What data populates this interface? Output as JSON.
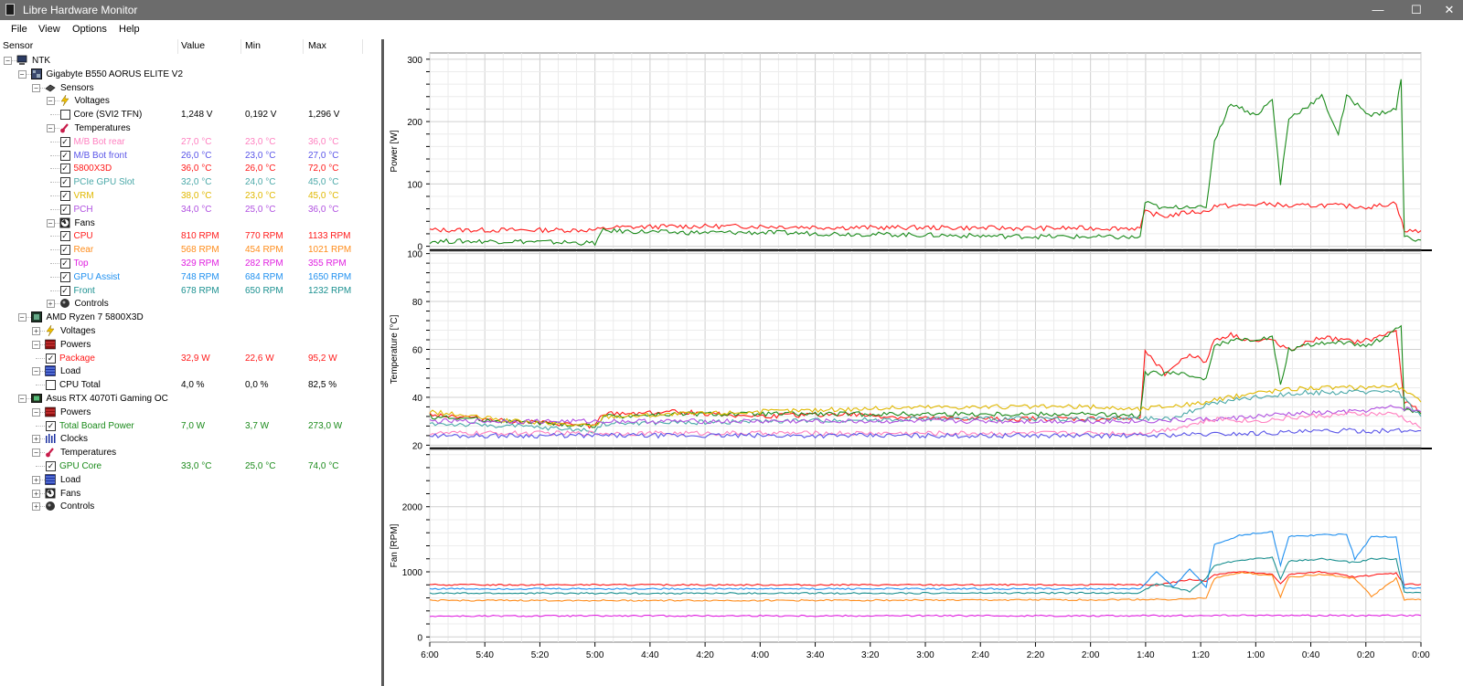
{
  "window": {
    "title": "Libre Hardware Monitor",
    "minimize": "—",
    "maximize": "☐",
    "close": "✕"
  },
  "menu": [
    "File",
    "View",
    "Options",
    "Help"
  ],
  "columns": {
    "sensor": "Sensor",
    "value": "Value",
    "min": "Min",
    "max": "Max"
  },
  "tree": [
    {
      "level": 0,
      "exp": "−",
      "icon": "computer-icon",
      "label": "NTK",
      "name": "computer-ntk"
    },
    {
      "level": 1,
      "exp": "−",
      "icon": "motherboard-icon",
      "label": "Gigabyte B550 AORUS ELITE V2",
      "name": "motherboard"
    },
    {
      "level": 2,
      "exp": "−",
      "icon": "chip-icon",
      "label": "Sensors",
      "name": "sensors-group"
    },
    {
      "level": 3,
      "exp": "−",
      "icon": "voltage-icon",
      "label": "Voltages",
      "name": "voltages-group"
    },
    {
      "level": 4,
      "check": false,
      "label": "Core (SVI2 TFN)",
      "value": "1,248 V",
      "min": "0,192 V",
      "max": "1,296 V",
      "color": "#000000",
      "name": "core-svi2-tfn"
    },
    {
      "level": 3,
      "exp": "−",
      "icon": "thermometer-icon",
      "label": "Temperatures",
      "name": "temperatures-group"
    },
    {
      "level": 4,
      "check": true,
      "label": "M/B Bot rear",
      "value": "27,0 °C",
      "min": "23,0 °C",
      "max": "36,0 °C",
      "color": "#ff80c0",
      "name": "mb-bot-rear"
    },
    {
      "level": 4,
      "check": true,
      "label": "M/B Bot front",
      "value": "26,0 °C",
      "min": "23,0 °C",
      "max": "27,0 °C",
      "color": "#5a55e8",
      "name": "mb-bot-front"
    },
    {
      "level": 4,
      "check": true,
      "label": "5800X3D",
      "value": "36,0 °C",
      "min": "26,0 °C",
      "max": "72,0 °C",
      "color": "#ff1a1a",
      "name": "temp-5800x3d"
    },
    {
      "level": 4,
      "check": true,
      "label": "PCIe GPU Slot",
      "value": "32,0 °C",
      "min": "24,0 °C",
      "max": "45,0 °C",
      "color": "#4aa8a8",
      "name": "pcie-gpu-slot"
    },
    {
      "level": 4,
      "check": true,
      "label": "VRM",
      "value": "38,0 °C",
      "min": "23,0 °C",
      "max": "45,0 °C",
      "color": "#e0b800",
      "name": "vrm"
    },
    {
      "level": 4,
      "check": true,
      "label": "PCH",
      "value": "34,0 °C",
      "min": "25,0 °C",
      "max": "36,0 °C",
      "color": "#b050e0",
      "name": "pch"
    },
    {
      "level": 3,
      "exp": "−",
      "icon": "fan-icon",
      "label": "Fans",
      "name": "fans-group"
    },
    {
      "level": 4,
      "check": true,
      "label": "CPU",
      "value": "810 RPM",
      "min": "770 RPM",
      "max": "1133 RPM",
      "color": "#ff1a1a",
      "name": "fan-cpu"
    },
    {
      "level": 4,
      "check": true,
      "label": "Rear",
      "value": "568 RPM",
      "min": "454 RPM",
      "max": "1021 RPM",
      "color": "#ff8c1a",
      "name": "fan-rear"
    },
    {
      "level": 4,
      "check": true,
      "label": "Top",
      "value": "329 RPM",
      "min": "282 RPM",
      "max": "355 RPM",
      "color": "#e020e0",
      "name": "fan-top"
    },
    {
      "level": 4,
      "check": true,
      "label": "GPU Assist",
      "value": "748 RPM",
      "min": "684 RPM",
      "max": "1650 RPM",
      "color": "#2090f0",
      "name": "fan-gpu-assist"
    },
    {
      "level": 4,
      "check": true,
      "label": "Front",
      "value": "678 RPM",
      "min": "650 RPM",
      "max": "1232 RPM",
      "color": "#1a9090",
      "name": "fan-front"
    },
    {
      "level": 3,
      "exp": "+",
      "icon": "controls-icon",
      "label": "Controls",
      "name": "controls-group-mb"
    },
    {
      "level": 1,
      "exp": "−",
      "icon": "cpu-icon",
      "label": "AMD Ryzen 7 5800X3D",
      "name": "cpu-device"
    },
    {
      "level": 2,
      "exp": "+",
      "icon": "voltage-icon",
      "label": "Voltages",
      "name": "cpu-voltages-group"
    },
    {
      "level": 2,
      "exp": "−",
      "icon": "power-icon",
      "label": "Powers",
      "name": "cpu-powers-group"
    },
    {
      "level": 3,
      "check": true,
      "label": "Package",
      "value": "32,9 W",
      "min": "22,6 W",
      "max": "95,2 W",
      "color": "#ff1a1a",
      "name": "cpu-package"
    },
    {
      "level": 2,
      "exp": "−",
      "icon": "load-icon",
      "label": "Load",
      "name": "cpu-load-group"
    },
    {
      "level": 3,
      "check": false,
      "label": "CPU Total",
      "value": "4,0 %",
      "min": "0,0 %",
      "max": "82,5 %",
      "color": "#000000",
      "name": "cpu-total"
    },
    {
      "level": 1,
      "exp": "−",
      "icon": "gpu-icon",
      "label": "Asus RTX 4070Ti Gaming OC",
      "name": "gpu-device"
    },
    {
      "level": 2,
      "exp": "−",
      "icon": "power-icon",
      "label": "Powers",
      "name": "gpu-powers-group"
    },
    {
      "level": 3,
      "check": true,
      "label": "Total Board Power",
      "value": "7,0 W",
      "min": "3,7 W",
      "max": "273,0 W",
      "color": "#1a8a1a",
      "name": "gpu-total-board-power"
    },
    {
      "level": 2,
      "exp": "+",
      "icon": "clock-icon",
      "label": "Clocks",
      "name": "gpu-clocks-group"
    },
    {
      "level": 2,
      "exp": "−",
      "icon": "thermometer-icon",
      "label": "Temperatures",
      "name": "gpu-temperatures-group"
    },
    {
      "level": 3,
      "check": true,
      "label": "GPU Core",
      "value": "33,0 °C",
      "min": "25,0 °C",
      "max": "74,0 °C",
      "color": "#1a8a1a",
      "name": "gpu-core-temp"
    },
    {
      "level": 2,
      "exp": "+",
      "icon": "load-icon",
      "label": "Load",
      "name": "gpu-load-group"
    },
    {
      "level": 2,
      "exp": "+",
      "icon": "fan-icon",
      "label": "Fans",
      "name": "gpu-fans-group"
    },
    {
      "level": 2,
      "exp": "+",
      "icon": "controls-icon",
      "label": "Controls",
      "name": "gpu-controls-group"
    }
  ],
  "chart_data": {
    "type": "line",
    "x_ticks": [
      "6:00",
      "5:40",
      "5:20",
      "5:00",
      "4:40",
      "4:20",
      "4:00",
      "3:40",
      "3:20",
      "3:00",
      "2:40",
      "2:20",
      "2:00",
      "1:40",
      "1:20",
      "1:00",
      "0:40",
      "0:20",
      "0:00"
    ],
    "panels": [
      {
        "ylabel": "Power [W]",
        "ylim": [
          -5,
          310
        ],
        "yticks": [
          0,
          100,
          200,
          300
        ],
        "series": [
          {
            "name": "Package",
            "color": "#ff1a1a",
            "x": [
              6,
              5,
              4.9,
              4.5,
              4,
              3.5,
              3,
              2.5,
              2,
              1.7,
              1.67,
              1.55,
              1.4,
              1.3,
              1.25,
              1.1,
              1.0,
              0.9,
              0.8,
              0.6,
              0.4,
              0.3,
              0.15,
              0.1,
              0
            ],
            "y": [
              26,
              26,
              30,
              32,
              32,
              30,
              30,
              29,
              29,
              29,
              55,
              48,
              55,
              55,
              65,
              65,
              67,
              68,
              64,
              66,
              64,
              63,
              70,
              24,
              25
            ]
          },
          {
            "name": "Total Board Power",
            "color": "#1a8a1a",
            "x": [
              6,
              5.5,
              5,
              4.95,
              4.5,
              4,
              3.5,
              3,
              2.5,
              2,
              1.7,
              1.67,
              1.55,
              1.4,
              1.3,
              1.25,
              1.15,
              1.0,
              0.9,
              0.85,
              0.8,
              0.6,
              0.5,
              0.45,
              0.3,
              0.15,
              0.12,
              0.1,
              0
            ],
            "y": [
              8,
              8,
              5,
              25,
              22,
              22,
              20,
              18,
              16,
              15,
              14,
              70,
              60,
              65,
              60,
              170,
              230,
              210,
              235,
              100,
              205,
              240,
              180,
              240,
              210,
              220,
              270,
              15,
              10
            ]
          }
        ]
      },
      {
        "ylabel": "Temperature [°C]",
        "ylim": [
          19,
          101
        ],
        "yticks": [
          20,
          40,
          60,
          80,
          100
        ],
        "series": [
          {
            "name": "5800X3D",
            "color": "#ff1a1a",
            "x": [
              6,
              5.5,
              5,
              4.95,
              4.5,
              4,
              3.5,
              3,
              2.5,
              2,
              1.7,
              1.67,
              1.55,
              1.4,
              1.3,
              1.25,
              1.15,
              1.0,
              0.9,
              0.8,
              0.6,
              0.4,
              0.3,
              0.15,
              0.1,
              0
            ],
            "y": [
              33,
              30,
              28,
              33,
              34,
              32,
              33,
              31,
              31,
              31,
              31,
              60,
              50,
              58,
              55,
              64,
              66,
              63,
              64,
              60,
              65,
              63,
              64,
              68,
              38,
              34
            ]
          },
          {
            "name": "GPU Core",
            "color": "#1a8a1a",
            "x": [
              6,
              5.5,
              5,
              4.95,
              4.5,
              4,
              3.5,
              3,
              2.5,
              2,
              1.7,
              1.67,
              1.5,
              1.3,
              1.25,
              1.1,
              0.9,
              0.85,
              0.8,
              0.6,
              0.3,
              0.12,
              0.1,
              0
            ],
            "y": [
              32,
              30,
              28,
              32,
              33,
              33,
              33,
              33,
              33,
              33,
              32,
              50,
              50,
              48,
              62,
              64,
              65,
              45,
              60,
              63,
              62,
              70,
              35,
              33
            ]
          },
          {
            "name": "VRM",
            "color": "#e0b800",
            "x": [
              6,
              5.5,
              5,
              4.95,
              4,
              3,
              2.5,
              2,
              1.7,
              1.6,
              1.4,
              1.3,
              1.0,
              0.7,
              0.4,
              0.15,
              0
            ],
            "y": [
              34,
              30,
              28,
              32,
              34,
              36,
              36,
              36,
              35,
              36,
              37,
              38,
              42,
              44,
              44,
              45,
              38
            ]
          },
          {
            "name": "PCIe GPU Slot",
            "color": "#4aa8a8",
            "x": [
              6,
              5.5,
              5,
              4.95,
              4,
              3,
              2,
              1.7,
              1.5,
              1.3,
              1.0,
              0.7,
              0.4,
              0.15,
              0
            ],
            "y": [
              29,
              28,
              26,
              29,
              30,
              31,
              31,
              31,
              31,
              37,
              40,
              42,
              42,
              43,
              32
            ]
          },
          {
            "name": "PCH",
            "color": "#b050e0",
            "x": [
              6,
              5,
              4.5,
              4,
              3,
              2,
              1.7,
              1.2,
              0.8,
              0.4,
              0.15,
              0
            ],
            "y": [
              30,
              30,
              30,
              30,
              30,
              30,
              30,
              31,
              33,
              34,
              36,
              34
            ]
          },
          {
            "name": "M/B Bot rear",
            "color": "#ff80c0",
            "x": [
              6,
              4,
              2,
              1.7,
              1.5,
              1.3,
              1.2,
              1.0,
              0.7,
              0.4,
              0.15,
              0
            ],
            "y": [
              25,
              25,
              25,
              25,
              27,
              30,
              31,
              30,
              32,
              33,
              33,
              27
            ]
          },
          {
            "name": "M/B Bot front",
            "color": "#5a55e8",
            "x": [
              6,
              4,
              2,
              1.7,
              1.0,
              0.5,
              0
            ],
            "y": [
              24,
              24,
              24,
              24,
              25,
              26,
              26
            ]
          }
        ]
      },
      {
        "ylabel": "Fan [RPM]",
        "ylim": [
          -80,
          2880
        ],
        "yticks": [
          0,
          1000,
          2000
        ],
        "series": [
          {
            "name": "CPU",
            "color": "#ff1a1a",
            "x": [
              6,
              4,
              2,
              1.7,
              1.6,
              1.4,
              1.3,
              1.25,
              1.1,
              0.9,
              0.85,
              0.8,
              0.6,
              0.4,
              0.25,
              0.15,
              0.1,
              0
            ],
            "y": [
              800,
              800,
              800,
              800,
              800,
              880,
              860,
              960,
              1000,
              960,
              820,
              960,
              1000,
              920,
              960,
              980,
              810,
              810
            ]
          },
          {
            "name": "Rear",
            "color": "#ff8c1a",
            "x": [
              6,
              4,
              2,
              1.7,
              1.4,
              1.3,
              1.25,
              1.1,
              0.9,
              0.85,
              0.8,
              0.6,
              0.4,
              0.3,
              0.15,
              0.1,
              0
            ],
            "y": [
              560,
              560,
              570,
              575,
              580,
              600,
              900,
              990,
              940,
              620,
              920,
              960,
              900,
              620,
              900,
              570,
              570
            ]
          },
          {
            "name": "Top",
            "color": "#e020e0",
            "x": [
              6,
              4,
              2,
              1.0,
              0
            ],
            "y": [
              320,
              325,
              325,
              330,
              330
            ]
          },
          {
            "name": "GPU Assist",
            "color": "#2090f0",
            "x": [
              6,
              4,
              2,
              1.7,
              1.6,
              1.5,
              1.4,
              1.3,
              1.25,
              1.1,
              0.9,
              0.85,
              0.8,
              0.6,
              0.45,
              0.4,
              0.3,
              0.15,
              0.1,
              0
            ],
            "y": [
              740,
              740,
              740,
              740,
              1000,
              760,
              1050,
              760,
              1420,
              1560,
              1620,
              1100,
              1540,
              1570,
              1580,
              1200,
              1540,
              1540,
              750,
              750
            ]
          },
          {
            "name": "Front",
            "color": "#1a9090",
            "x": [
              6,
              4,
              2,
              1.7,
              1.6,
              1.4,
              1.3,
              1.25,
              1.1,
              0.9,
              0.85,
              0.8,
              0.6,
              0.4,
              0.3,
              0.15,
              0.1,
              0
            ],
            "y": [
              670,
              670,
              675,
              678,
              820,
              700,
              900,
              1100,
              1180,
              1220,
              900,
              1160,
              1200,
              1140,
              1200,
              1200,
              680,
              680
            ]
          }
        ]
      }
    ]
  }
}
